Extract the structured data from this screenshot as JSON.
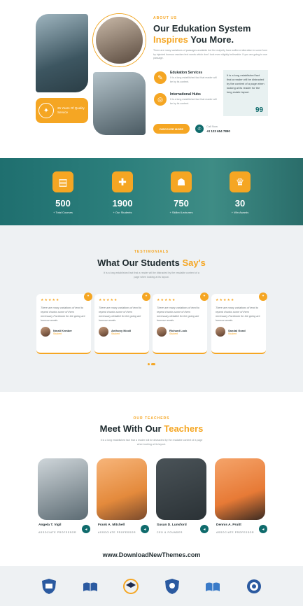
{
  "about": {
    "tag": "ABOUT US",
    "title_line1": "Our Edukation System",
    "title_orange": "Inspires",
    "title_rest": " You More.",
    "desc": "There are many variations of passages available but the majority have suffered alteration in some form by injected humour random text words which don't look even slightly believable. If you are going to use passage.",
    "exp_text": "25 Years Of Quality Service",
    "features": [
      {
        "title": "Edukation Services",
        "desc": "It is a long established fact that reader will be by its content.",
        "icon": "book-icon"
      },
      {
        "title": "International Hubs",
        "desc": "It is a long established fact that reader will be by its content.",
        "icon": "globe-icon"
      }
    ],
    "quote": "It is a long established fact that a reader will be distracted by the content of a page when looking at its reader for the long estate layout.",
    "quote_mark": "99",
    "button": "DISCOVER MORE",
    "call_label": "Call Now",
    "phone": "+0 123 654 7890"
  },
  "stats": [
    {
      "num": "500",
      "label": "+ Total Courses",
      "icon": "courses-icon"
    },
    {
      "num": "1900",
      "label": "+ Our Students",
      "icon": "students-icon"
    },
    {
      "num": "750",
      "label": "+ Skilled Lecturers",
      "icon": "lecturers-icon"
    },
    {
      "num": "30",
      "label": "+ Win Awards",
      "icon": "awards-icon"
    }
  ],
  "testimonials": {
    "tag": "TESTIMONIALS",
    "title": "What Our Students ",
    "title_orange": "Say's",
    "sub": "It is a long established fact that a reader will be distracted by the readable content of a page when looking at its layout.",
    "cards": [
      {
        "text": "There are many variations of tend to repeat chunks some of them necessary Facebook for the going are humour words.",
        "name": "Nmali Kember",
        "role": "Student"
      },
      {
        "text": "There are many variations of tend to repeat chunks some of them necessary detailed for the going are humour words.",
        "name": "Anthony Nicoll",
        "role": "Student"
      },
      {
        "text": "There are many variations of tend to repeat chunks some of them necessary detailed for the going are humour words.",
        "name": "Richard Lock",
        "role": "Student"
      },
      {
        "text": "There are many variations of tend to repeat chunks some of them necessary Facebook for the going are humour words.",
        "name": "Sandal Gond",
        "role": "Student"
      }
    ]
  },
  "teachers": {
    "tag": "OUR TEACHERS",
    "title": "Meet With Our ",
    "title_orange": "Teachers",
    "sub": "It is a long established fact that a reader will be distracted by the readable content of a page when looking at its layout.",
    "list": [
      {
        "name": "Angela T. Vigil",
        "role": "ASSOCIATE PROFESSOR"
      },
      {
        "name": "Frank A. Mitchell",
        "role": "ASSOCIATE PROFESSOR"
      },
      {
        "name": "Susan D. Lunsford",
        "role": "CEO & FOUNDER"
      },
      {
        "name": "Dennis A. Pruitt",
        "role": "ASSOCIATE PROFESSOR"
      }
    ]
  },
  "watermark": "www.DownloadNewThemes.com",
  "colors": {
    "accent": "#f5a623",
    "teal": "#0f6b6c",
    "dark": "#1f2b2f"
  }
}
